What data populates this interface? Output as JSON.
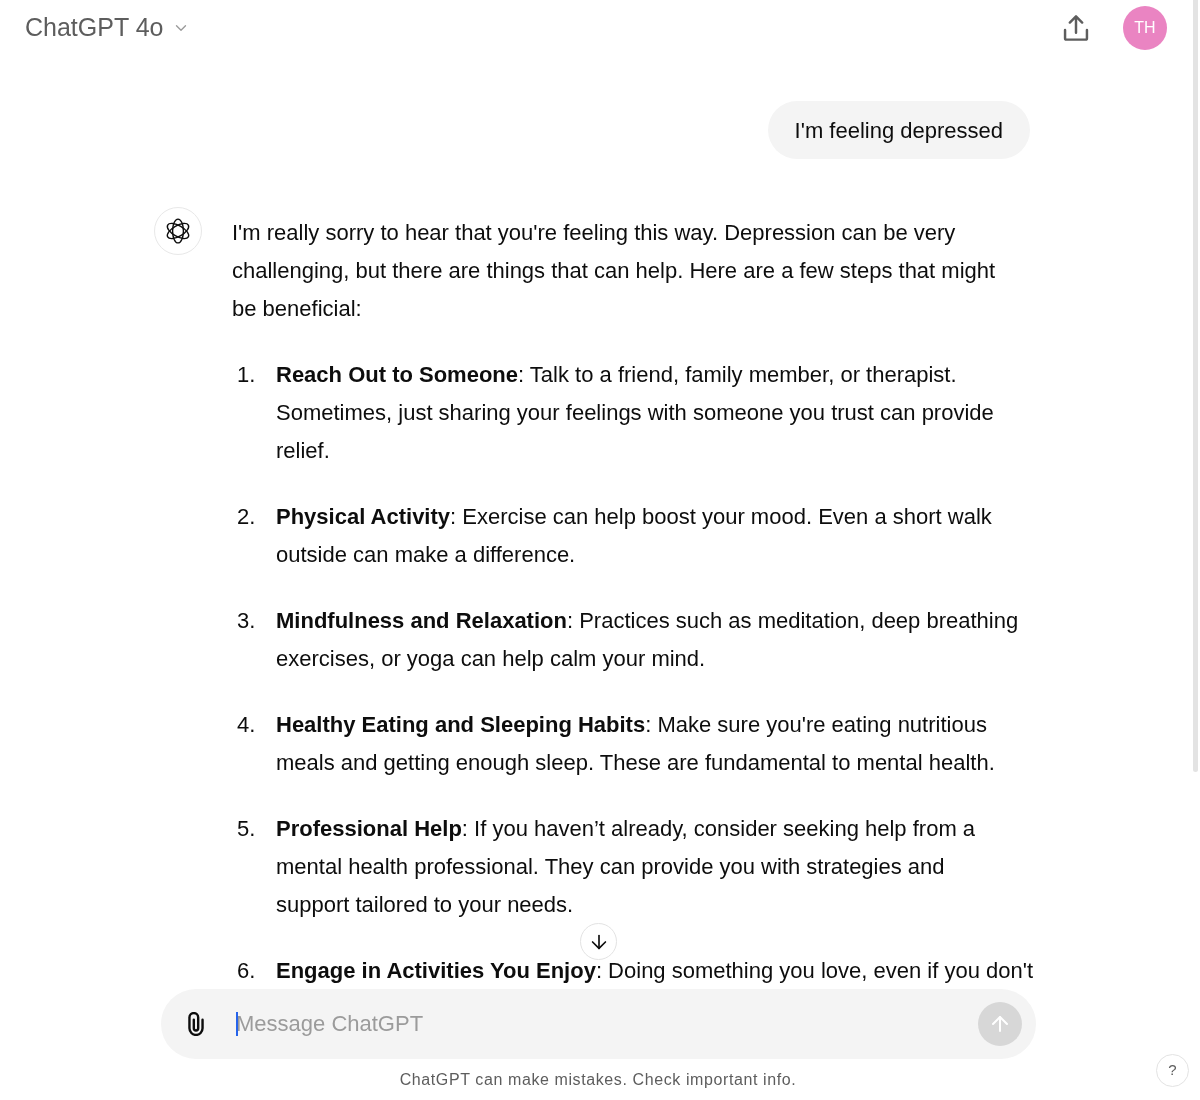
{
  "header": {
    "model_name": "ChatGPT 4o",
    "avatar_initials": "TH"
  },
  "conversation": [
    {
      "kind": "user",
      "text": "I'm feeling depressed"
    },
    {
      "kind": "assistant",
      "intro": "I'm really sorry to hear that you're feeling this way. Depression can be very challenging, but there are things that can help. Here are a few steps that might be beneficial:",
      "list": [
        {
          "number": "1.",
          "text": "**Reach Out to Someone**: Talk to a friend, family member, or therapist. Sometimes, just sharing your feelings with someone you trust can provide relief.",
          "cut_off": false
        },
        {
          "number": "2.",
          "text": "**Physical Activity**: Exercise can help boost your mood. Even a short walk outside can make a difference.",
          "cut_off": false
        },
        {
          "number": "3.",
          "text": "**Mindfulness and Relaxation**: Practices such as meditation, deep breathing exercises, or yoga can help calm your mind.",
          "cut_off": false
        },
        {
          "number": "4.",
          "text": "**Healthy Eating and Sleeping Habits**: Make sure you're eating nutritious meals and getting enough sleep. These are fundamental to mental health.",
          "cut_off": false
        },
        {
          "number": "5.",
          "text": "**Professional Help**: If you haven’t already, consider seeking help from a mental health professional. They can provide you with strategies and support tailored to your needs.",
          "cut_off": false
        },
        {
          "number": "6.",
          "text": "**Engage in Activities You Enjoy**: Doing something you love, even if you don't",
          "cut_off": true
        }
      ]
    }
  ],
  "composer": {
    "placeholder": "Message ChatGPT",
    "send_disabled": true
  },
  "disclaimer": "ChatGPT can make mistakes. Check important info.",
  "help_button": "?"
}
